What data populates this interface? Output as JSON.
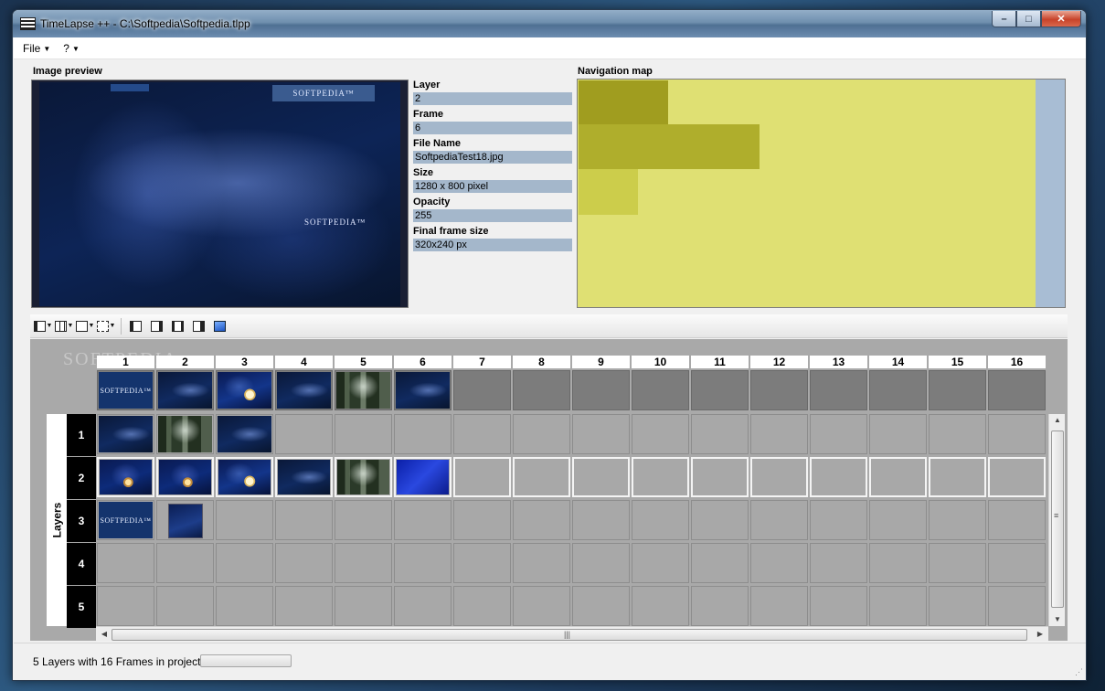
{
  "window": {
    "title": "TimeLapse ++ - C:\\Softpedia\\Softpedia.tlpp",
    "minimize_glyph": "–",
    "maximize_glyph": "□",
    "close_glyph": "✕"
  },
  "menu": [
    {
      "label": "File",
      "arrow": "▼"
    },
    {
      "label": "?",
      "arrow": "▼"
    }
  ],
  "preview": {
    "label": "Image preview",
    "logo_top": "SOFTPEDIA™",
    "logo_mid": "SOFTPEDIA™"
  },
  "properties": [
    {
      "label": "Layer",
      "value": "2"
    },
    {
      "label": "Frame",
      "value": "6"
    },
    {
      "label": "File Name",
      "value": "SoftpediaTest18.jpg"
    },
    {
      "label": "Size",
      "value": "1280 x 800 pixel"
    },
    {
      "label": "Opacity",
      "value": "255"
    },
    {
      "label": "Final frame size",
      "value": "320x240 px"
    }
  ],
  "navmap": {
    "label": "Navigation map",
    "background": "#dfe073",
    "blocks": [
      {
        "color": "#a09d1f"
      },
      {
        "color": "#afae2c"
      },
      {
        "color": "#cccd4b"
      }
    ]
  },
  "toolbar": {
    "icons": [
      "select-mode-icon",
      "grid-layout-icon",
      "frame-icon",
      "frame-fit-icon",
      "insert-frame-before-icon",
      "insert-frame-after-icon",
      "delete-frame-icon",
      "append-frame-icon",
      "image-icon"
    ]
  },
  "timeline": {
    "watermark": "SOFTPEDIA",
    "layers_label": "Layers",
    "columns": [
      "1",
      "2",
      "3",
      "4",
      "5",
      "6",
      "7",
      "8",
      "9",
      "10",
      "11",
      "12",
      "13",
      "14",
      "15",
      "16"
    ],
    "rows": [
      "1",
      "2",
      "3",
      "4",
      "5"
    ],
    "master_thumbs": [
      "logo",
      "dark",
      "moon",
      "dark",
      "forest",
      "dark",
      "",
      "",
      "",
      "",
      "",
      "",
      "",
      "",
      "",
      ""
    ],
    "layer_thumbs": [
      [
        "dark",
        "forest",
        "dark",
        "",
        "",
        "",
        "",
        "",
        "",
        "",
        "",
        "",
        "",
        "",
        "",
        ""
      ],
      [
        "swirl",
        "swirl",
        "moon",
        "dark",
        "forest",
        "blue",
        "",
        "",
        "",
        "",
        "",
        "",
        "",
        "",
        "",
        ""
      ],
      [
        "logo",
        "small",
        "",
        "",
        "",
        "",
        "",
        "",
        "",
        "",
        "",
        "",
        "",
        "",
        "",
        ""
      ],
      [
        "",
        "",
        "",
        "",
        "",
        "",
        "",
        "",
        "",
        "",
        "",
        "",
        "",
        "",
        "",
        ""
      ],
      [
        "",
        "",
        "",
        "",
        "",
        "",
        "",
        "",
        "",
        "",
        "",
        "",
        "",
        "",
        "",
        ""
      ]
    ],
    "logo_text": "SOFTPEDIA™",
    "hscroll_grip": "|||",
    "vscroll_grip": "≡",
    "arrow_left": "◀",
    "arrow_right": "▶",
    "arrow_up": "▲",
    "arrow_down": "▼"
  },
  "status": {
    "text": "5 Layers with 16 Frames in project",
    "progress": 0
  }
}
